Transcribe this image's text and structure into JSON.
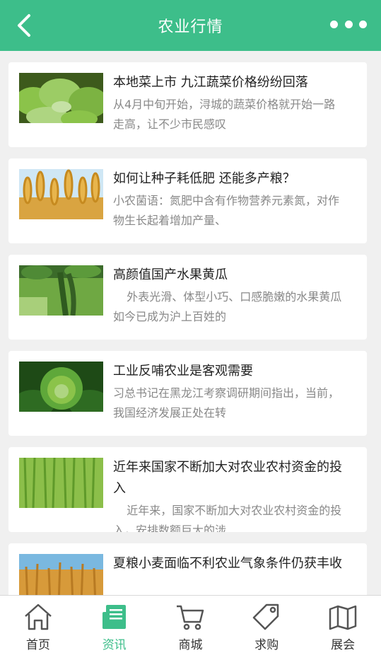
{
  "header": {
    "title": "农业行情"
  },
  "articles": [
    {
      "title": "本地菜上市 九江蔬菜价格纷纷回落",
      "summary": "从4月中旬开始，浔城的蔬菜价格就开始一路走高，让不少市民感叹"
    },
    {
      "title": "如何让种子耗低肥 还能多产粮？",
      "summary": "小农菌语：氮肥中含有作物营养元素氮，对作物生长起着增加产量、"
    },
    {
      "title": "高颜值国产水果黄瓜",
      "summary": "外表光滑、体型小巧、口感脆嫩的水果黄瓜如今已成为沪上百姓的"
    },
    {
      "title": "工业反哺农业是客观需要",
      "summary": "习总书记在黑龙江考察调研期间指出，当前，我国经济发展正处在转"
    },
    {
      "title": "近年来国家不断加大对农业农村资金的投入",
      "summary": "近年来，国家不断加大对农业农村资金的投入，安排数额巨大的涉"
    },
    {
      "title": "夏粮小麦面临不利农业气象条件仍获丰收",
      "summary": ""
    }
  ],
  "tabs": [
    {
      "label": "首页",
      "icon": "home-icon"
    },
    {
      "label": "资讯",
      "icon": "news-icon"
    },
    {
      "label": "商城",
      "icon": "cart-icon"
    },
    {
      "label": "求购",
      "icon": "tag-icon"
    },
    {
      "label": "展会",
      "icon": "map-icon"
    }
  ],
  "colors": {
    "accent": "#3dbe8a",
    "background": "#f0f0f0",
    "title_text": "#222222",
    "summary_text": "#888888"
  }
}
